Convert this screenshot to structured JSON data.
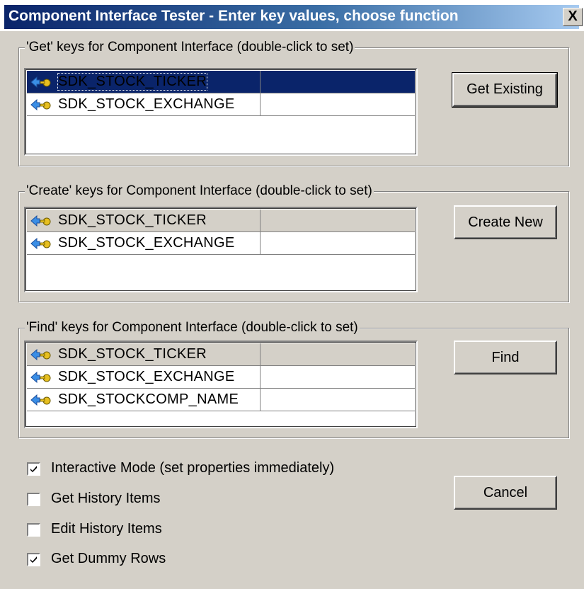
{
  "window": {
    "title": "Component Interface Tester - Enter key values, choose function",
    "close_label": "X"
  },
  "get_group": {
    "legend": "'Get' keys for Component Interface (double-click to set)",
    "keys": [
      {
        "name": "SDK_STOCK_TICKER",
        "value": ""
      },
      {
        "name": "SDK_STOCK_EXCHANGE",
        "value": ""
      }
    ],
    "button_label": "Get Existing"
  },
  "create_group": {
    "legend": "'Create' keys for Component Interface (double-click to set)",
    "keys": [
      {
        "name": "SDK_STOCK_TICKER",
        "value": ""
      },
      {
        "name": "SDK_STOCK_EXCHANGE",
        "value": ""
      }
    ],
    "button_label": "Create New"
  },
  "find_group": {
    "legend": "'Find' keys for Component Interface (double-click to set)",
    "keys": [
      {
        "name": "SDK_STOCK_TICKER",
        "value": ""
      },
      {
        "name": "SDK_STOCK_EXCHANGE",
        "value": ""
      },
      {
        "name": "SDK_STOCKCOMP_NAME",
        "value": ""
      }
    ],
    "button_label": "Find"
  },
  "options": [
    {
      "label": "Interactive Mode (set properties immediately)",
      "checked": true
    },
    {
      "label": "Get History Items",
      "checked": false
    },
    {
      "label": "Edit History Items",
      "checked": false
    },
    {
      "label": "Get Dummy Rows",
      "checked": true
    }
  ],
  "cancel_label": "Cancel",
  "icons": {
    "key_row": "key-icon"
  }
}
